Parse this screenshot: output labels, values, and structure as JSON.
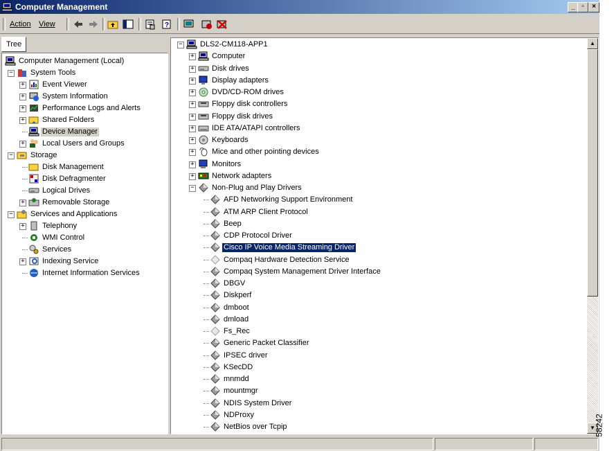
{
  "window": {
    "title": "Computer Management",
    "code": "58242"
  },
  "menu": {
    "action": "Action",
    "view": "View"
  },
  "left_tab": "Tree",
  "left_tree": [
    {
      "label": "Computer Management (Local)",
      "depth": 0,
      "icon": "computer-management-icon",
      "expander": "none"
    },
    {
      "label": "System Tools",
      "depth": 1,
      "icon": "system-tools-icon",
      "expander": "minus"
    },
    {
      "label": "Event Viewer",
      "depth": 2,
      "icon": "event-viewer-icon",
      "expander": "plus"
    },
    {
      "label": "System Information",
      "depth": 2,
      "icon": "system-information-icon",
      "expander": "plus"
    },
    {
      "label": "Performance Logs and Alerts",
      "depth": 2,
      "icon": "performance-logs-icon",
      "expander": "plus"
    },
    {
      "label": "Shared Folders",
      "depth": 2,
      "icon": "shared-folders-icon",
      "expander": "plus"
    },
    {
      "label": "Device Manager",
      "depth": 2,
      "icon": "device-manager-icon",
      "expander": "none",
      "selected": true
    },
    {
      "label": "Local Users and Groups",
      "depth": 2,
      "icon": "local-users-icon",
      "expander": "plus"
    },
    {
      "label": "Storage",
      "depth": 1,
      "icon": "storage-icon",
      "expander": "minus"
    },
    {
      "label": "Disk Management",
      "depth": 2,
      "icon": "disk-management-icon",
      "expander": "none"
    },
    {
      "label": "Disk Defragmenter",
      "depth": 2,
      "icon": "disk-defragmenter-icon",
      "expander": "none"
    },
    {
      "label": "Logical Drives",
      "depth": 2,
      "icon": "logical-drives-icon",
      "expander": "none"
    },
    {
      "label": "Removable Storage",
      "depth": 2,
      "icon": "removable-storage-icon",
      "expander": "plus"
    },
    {
      "label": "Services and Applications",
      "depth": 1,
      "icon": "services-applications-icon",
      "expander": "minus"
    },
    {
      "label": "Telephony",
      "depth": 2,
      "icon": "telephony-icon",
      "expander": "plus"
    },
    {
      "label": "WMI Control",
      "depth": 2,
      "icon": "wmi-control-icon",
      "expander": "none"
    },
    {
      "label": "Services",
      "depth": 2,
      "icon": "services-icon",
      "expander": "none"
    },
    {
      "label": "Indexing Service",
      "depth": 2,
      "icon": "indexing-service-icon",
      "expander": "plus"
    },
    {
      "label": "Internet Information Services",
      "depth": 2,
      "icon": "iis-icon",
      "expander": "none"
    }
  ],
  "device_tree": [
    {
      "label": "DLS2-CM118-APP1",
      "depth": 0,
      "icon": "computer-icon",
      "expander": "minus"
    },
    {
      "label": "Computer",
      "depth": 1,
      "icon": "computer-icon",
      "expander": "plus"
    },
    {
      "label": "Disk drives",
      "depth": 1,
      "icon": "disk-drive-icon",
      "expander": "plus"
    },
    {
      "label": "Display adapters",
      "depth": 1,
      "icon": "display-adapter-icon",
      "expander": "plus"
    },
    {
      "label": "DVD/CD-ROM drives",
      "depth": 1,
      "icon": "cdrom-icon",
      "expander": "plus"
    },
    {
      "label": "Floppy disk controllers",
      "depth": 1,
      "icon": "floppy-controller-icon",
      "expander": "plus"
    },
    {
      "label": "Floppy disk drives",
      "depth": 1,
      "icon": "floppy-drive-icon",
      "expander": "plus"
    },
    {
      "label": "IDE ATA/ATAPI controllers",
      "depth": 1,
      "icon": "ide-controller-icon",
      "expander": "plus"
    },
    {
      "label": "Keyboards",
      "depth": 1,
      "icon": "keyboard-icon",
      "expander": "plus"
    },
    {
      "label": "Mice and other pointing devices",
      "depth": 1,
      "icon": "mouse-icon",
      "expander": "plus"
    },
    {
      "label": "Monitors",
      "depth": 1,
      "icon": "monitor-icon",
      "expander": "plus"
    },
    {
      "label": "Network adapters",
      "depth": 1,
      "icon": "network-adapter-icon",
      "expander": "plus"
    },
    {
      "label": "Non-Plug and Play Drivers",
      "depth": 1,
      "icon": "driver-icon",
      "expander": "minus"
    },
    {
      "label": "AFD Networking Support Environment",
      "depth": 2,
      "icon": "driver-icon",
      "expander": "none"
    },
    {
      "label": "ATM ARP Client Protocol",
      "depth": 2,
      "icon": "driver-icon",
      "expander": "none"
    },
    {
      "label": "Beep",
      "depth": 2,
      "icon": "driver-icon",
      "expander": "none"
    },
    {
      "label": "CDP Protocol Driver",
      "depth": 2,
      "icon": "driver-icon",
      "expander": "none"
    },
    {
      "label": "Cisco IP Voice Media Streaming Driver",
      "depth": 2,
      "icon": "driver-icon",
      "expander": "none",
      "selected": true
    },
    {
      "label": "Compaq Hardware Detection Service",
      "depth": 2,
      "icon": "driver-disabled-icon",
      "expander": "none"
    },
    {
      "label": "Compaq System Management Driver Interface",
      "depth": 2,
      "icon": "driver-icon",
      "expander": "none"
    },
    {
      "label": "DBGV",
      "depth": 2,
      "icon": "driver-icon",
      "expander": "none"
    },
    {
      "label": "Diskperf",
      "depth": 2,
      "icon": "driver-icon",
      "expander": "none"
    },
    {
      "label": "dmboot",
      "depth": 2,
      "icon": "driver-icon",
      "expander": "none"
    },
    {
      "label": "dmload",
      "depth": 2,
      "icon": "driver-icon",
      "expander": "none"
    },
    {
      "label": "Fs_Rec",
      "depth": 2,
      "icon": "driver-disabled-icon",
      "expander": "none"
    },
    {
      "label": "Generic Packet Classifier",
      "depth": 2,
      "icon": "driver-icon",
      "expander": "none"
    },
    {
      "label": "IPSEC driver",
      "depth": 2,
      "icon": "driver-icon",
      "expander": "none"
    },
    {
      "label": "KSecDD",
      "depth": 2,
      "icon": "driver-icon",
      "expander": "none"
    },
    {
      "label": "mnmdd",
      "depth": 2,
      "icon": "driver-icon",
      "expander": "none"
    },
    {
      "label": "mountmgr",
      "depth": 2,
      "icon": "driver-icon",
      "expander": "none"
    },
    {
      "label": "NDIS System Driver",
      "depth": 2,
      "icon": "driver-icon",
      "expander": "none"
    },
    {
      "label": "NDProxy",
      "depth": 2,
      "icon": "driver-icon",
      "expander": "none"
    },
    {
      "label": "NetBios over Tcpip",
      "depth": 2,
      "icon": "driver-icon",
      "expander": "none"
    }
  ]
}
